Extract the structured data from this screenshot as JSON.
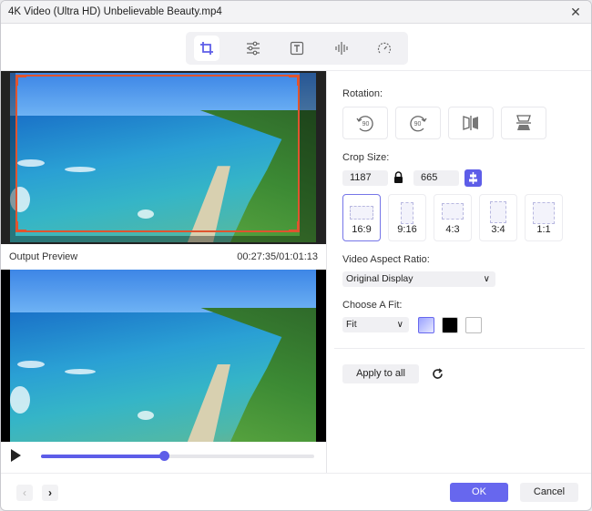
{
  "window": {
    "title": "4K Video (Ultra HD) Unbelievable Beauty.mp4",
    "close_icon": "close-icon"
  },
  "toolbar": {
    "tabs": [
      {
        "name": "crop",
        "icon": "crop-icon",
        "active": true
      },
      {
        "name": "effects",
        "icon": "sliders-icon",
        "active": false
      },
      {
        "name": "watermark",
        "icon": "text-icon",
        "active": false
      },
      {
        "name": "audio",
        "icon": "audio-wave-icon",
        "active": false
      },
      {
        "name": "speed",
        "icon": "speedometer-icon",
        "active": false
      }
    ]
  },
  "preview": {
    "label": "Output Preview",
    "time": "00:27:35/01:01:13",
    "progress": 0.45
  },
  "rotation": {
    "label": "Rotation:",
    "buttons": [
      {
        "name": "rotate-left-90",
        "text": "90"
      },
      {
        "name": "rotate-right-90",
        "text": "90"
      },
      {
        "name": "flip-horizontal"
      },
      {
        "name": "flip-vertical"
      }
    ]
  },
  "crop": {
    "label": "Crop Size:",
    "width": "1187",
    "height": "665",
    "ratios": [
      {
        "label": "16:9",
        "selected": true
      },
      {
        "label": "9:16",
        "selected": false
      },
      {
        "label": "4:3",
        "selected": false
      },
      {
        "label": "3:4",
        "selected": false
      },
      {
        "label": "1:1",
        "selected": false
      }
    ]
  },
  "aspect": {
    "label": "Video Aspect Ratio:",
    "value": "Original Display"
  },
  "fit": {
    "label": "Choose A Fit:",
    "value": "Fit",
    "swatches": [
      {
        "name": "blur",
        "selected": true
      },
      {
        "name": "black",
        "color": "#000000",
        "selected": false
      },
      {
        "name": "white",
        "color": "#ffffff",
        "selected": false
      }
    ]
  },
  "actions": {
    "apply_all": "Apply to all",
    "ok": "OK",
    "cancel": "Cancel"
  },
  "colors": {
    "accent": "#6767ee",
    "crop_border": "#e0542f"
  }
}
